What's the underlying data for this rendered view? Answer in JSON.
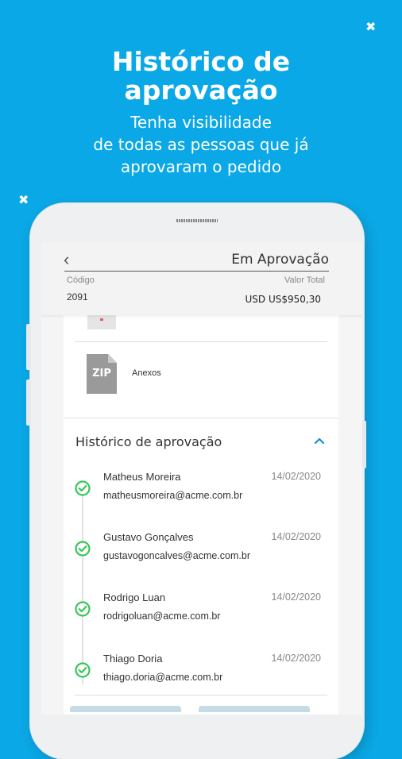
{
  "promo": {
    "title_line1": "Histórico de",
    "title_line2": "aprovação",
    "subtitle_line1": "Tenha visibilidade",
    "subtitle_line2": "de todas as pessoas que já",
    "subtitle_line3": "aprovaram o pedido"
  },
  "appbar": {
    "title": "Em Aprovação",
    "code_label": "Código",
    "code_value": "2091",
    "total_label": "Valor Total",
    "total_value": "USD US$950,30"
  },
  "attachments": {
    "file_type": "ZIP",
    "label": "Anexos"
  },
  "history": {
    "title": "Histórico de aprovação",
    "entries": [
      {
        "name": "Matheus Moreira",
        "email": "matheusmoreira@acme.com.br",
        "date": "14/02/2020"
      },
      {
        "name": "Gustavo Gonçalves",
        "email": "gustavogoncalves@acme.com.br",
        "date": "14/02/2020"
      },
      {
        "name": "Rodrigo Luan",
        "email": "rodrigoluan@acme.com.br",
        "date": "14/02/2020"
      },
      {
        "name": "Thiago Doria",
        "email": "thiago.doria@acme.com.br",
        "date": "14/02/2020"
      }
    ]
  },
  "colors": {
    "background": "#0aa8e6",
    "accent": "#1a8fd1",
    "check": "#34c759"
  }
}
